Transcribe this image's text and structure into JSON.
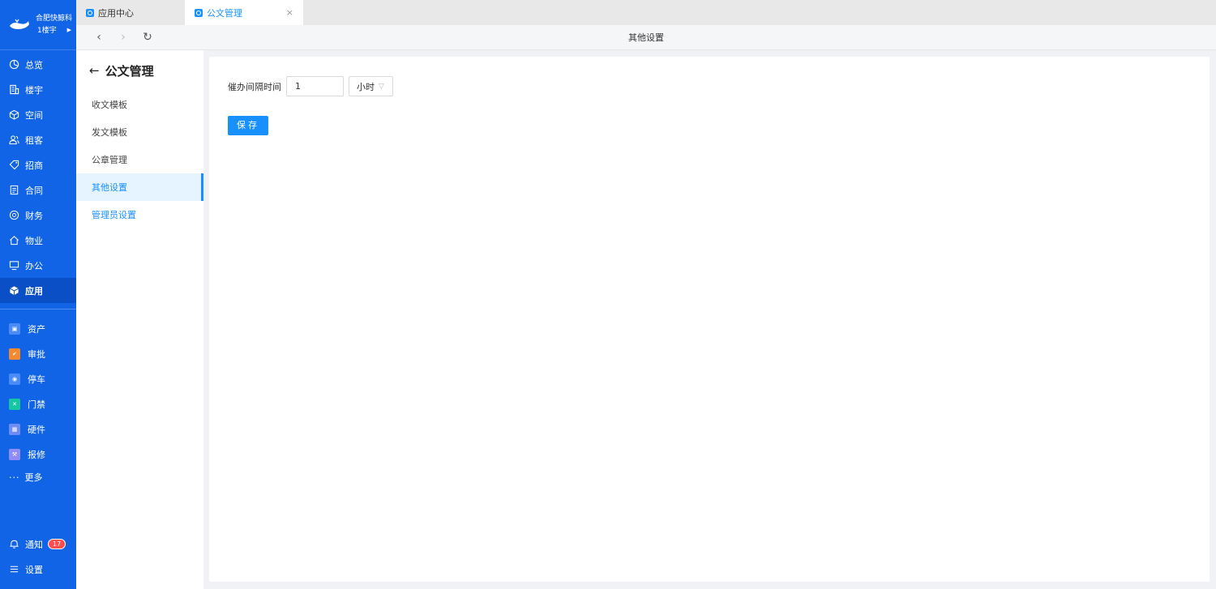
{
  "brand": {
    "name": "合肥快鲸科",
    "building": "1楼宇"
  },
  "nav": {
    "items": [
      {
        "label": "总览",
        "icon": "dashboard-icon"
      },
      {
        "label": "楼宇",
        "icon": "building-icon"
      },
      {
        "label": "空间",
        "icon": "cube-icon"
      },
      {
        "label": "租客",
        "icon": "users-icon"
      },
      {
        "label": "招商",
        "icon": "tag-icon"
      },
      {
        "label": "合同",
        "icon": "document-icon"
      },
      {
        "label": "财务",
        "icon": "coin-icon"
      },
      {
        "label": "物业",
        "icon": "home-icon"
      },
      {
        "label": "办公",
        "icon": "monitor-icon"
      },
      {
        "label": "应用",
        "icon": "app-cube-icon"
      }
    ],
    "apps": [
      {
        "label": "资产",
        "color": "#4a8cf7"
      },
      {
        "label": "审批",
        "color": "#f5892d"
      },
      {
        "label": "停车",
        "color": "#4a8cf7"
      },
      {
        "label": "门禁",
        "color": "#16c6a3"
      },
      {
        "label": "硬件",
        "color": "#6e8cf7"
      },
      {
        "label": "报修",
        "color": "#8f8cf7"
      }
    ],
    "more": "更多",
    "notify": {
      "label": "通知",
      "count": "17"
    },
    "settings": "设置"
  },
  "tabs": [
    {
      "label": "应用中心"
    },
    {
      "label": "公文管理",
      "close": "×"
    }
  ],
  "toolbar": {
    "back": "‹",
    "forward": "›",
    "refresh": "↻",
    "title": "其他设置"
  },
  "submenu": {
    "back_arrow": "←",
    "title": "公文管理",
    "items": [
      "收文模板",
      "发文模板",
      "公章管理",
      "其他设置",
      "管理员设置"
    ]
  },
  "form": {
    "label": "催办间隔时间",
    "interval_value": "1",
    "unit": "小时",
    "save": "保存"
  }
}
